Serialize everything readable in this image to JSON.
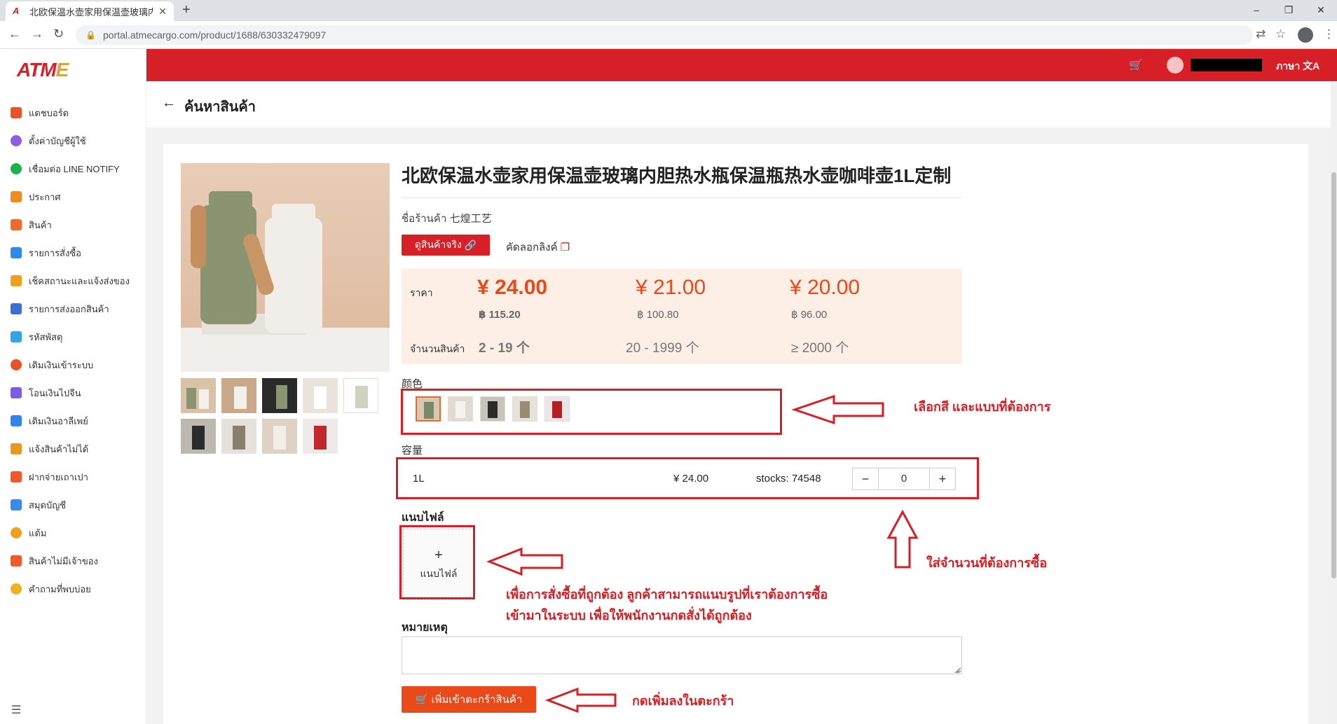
{
  "browser": {
    "tab_title": "北欧保温水壶家用保温壶玻璃内胆",
    "url": "portal.atmecargo.com/product/1688/630332479097"
  },
  "logo": {
    "text_a": "ATM",
    "text_e": "E"
  },
  "sidebar": {
    "items": [
      {
        "label": "แดชบอร์ด",
        "color": "#e8542a"
      },
      {
        "label": "ตั้งค่าบัญชีผู้ใช้",
        "color": "#8f5ce6"
      },
      {
        "label": "เชื่อมต่อ LINE NOTIFY",
        "color": "#19b34b"
      },
      {
        "label": "ประกาศ",
        "color": "#f08a24"
      },
      {
        "label": "สินค้า",
        "color": "#ef6b2a"
      },
      {
        "label": "รายการสั่งซื้อ",
        "color": "#2b8be6"
      },
      {
        "label": "เช็คสถานะและแจ้งส่งของ",
        "color": "#f0a020"
      },
      {
        "label": "รายการส่งออกสินค้า",
        "color": "#3b6fd6"
      },
      {
        "label": "รหัสพัสดุ",
        "color": "#35a3e6"
      },
      {
        "label": "เติมเงินเข้าระบบ",
        "color": "#e8542a"
      },
      {
        "label": "โอนเงินไปจีน",
        "color": "#7b5ce6"
      },
      {
        "label": "เติมเงินอาลีเพย์",
        "color": "#2f86e6"
      },
      {
        "label": "แจ้งสินค้าไม่ได้",
        "color": "#e89a20"
      },
      {
        "label": "ฝากจ่ายเถาเปา",
        "color": "#ef5a2a"
      },
      {
        "label": "สมุดบัญชี",
        "color": "#3b8be6"
      },
      {
        "label": "แต้ม",
        "color": "#f0a020"
      },
      {
        "label": "สินค้าไม่มีเจ้าของ",
        "color": "#ef5a2a"
      },
      {
        "label": "คำถามที่พบบ่อย",
        "color": "#f0b020"
      }
    ]
  },
  "header": {
    "lang_label": "ภาษา",
    "lang_icon": "文A"
  },
  "page": {
    "title": "ค้นหาสินค้า"
  },
  "product": {
    "title": "北欧保温水壶家用保温壶玻璃内胆热水瓶保温瓶热水壶咖啡壶1L定制",
    "shop_label": "ชื่อร้านค้า",
    "shop_name": "七煌工艺",
    "view_button": "ดูสินค้าจริง",
    "copy_link": "คัดลอกลิงค์"
  },
  "pricing": {
    "price_label": "ราคา",
    "qty_label": "จำนวนสินค้า",
    "tiers": [
      {
        "cny": "¥ 24.00",
        "thb": "฿ 115.20",
        "qty": "2 - 19 个"
      },
      {
        "cny": "¥ 21.00",
        "thb": "฿ 100.80",
        "qty": "20 - 1999 个"
      },
      {
        "cny": "¥ 20.00",
        "thb": "฿ 96.00",
        "qty": "≥ 2000 个"
      }
    ]
  },
  "color_section": {
    "label": "颜色",
    "swatches": [
      "#7a8a68",
      "#e9e4dc",
      "#2b2b2b",
      "#d6c3ad",
      "#b81f24"
    ]
  },
  "capacity_section": {
    "label": "容量",
    "sku_name": "1L",
    "sku_price": "¥ 24.00",
    "sku_stock": "stocks: 74548",
    "qty_value": "0",
    "minus": "−",
    "plus": "+"
  },
  "attachment": {
    "label": "แนบไฟล์",
    "button_plus": "+",
    "button_label": "แนบไฟล์"
  },
  "note": {
    "label": "หมายเหตุ",
    "value": ""
  },
  "add_cart_button": "เพิ่มเข้าตะกร้าสินค้า",
  "annotations": {
    "color_hint": "เลือกสี และแบบที่ต้องการ",
    "qty_hint": "ใส่จำนวนที่ต้องการซื้อ",
    "file_hint_1": "เพื่อการสั่งซื้อที่ถูกต้อง ลูกค้าสามารถแนบรูปที่เราต้องการซื้อ",
    "file_hint_2": "เข้ามาในระบบ เพื่อให้พนักงานกดสั่งได้ถูกต้อง",
    "cart_hint": "กดเพิ่มลงในตะกร้า"
  }
}
